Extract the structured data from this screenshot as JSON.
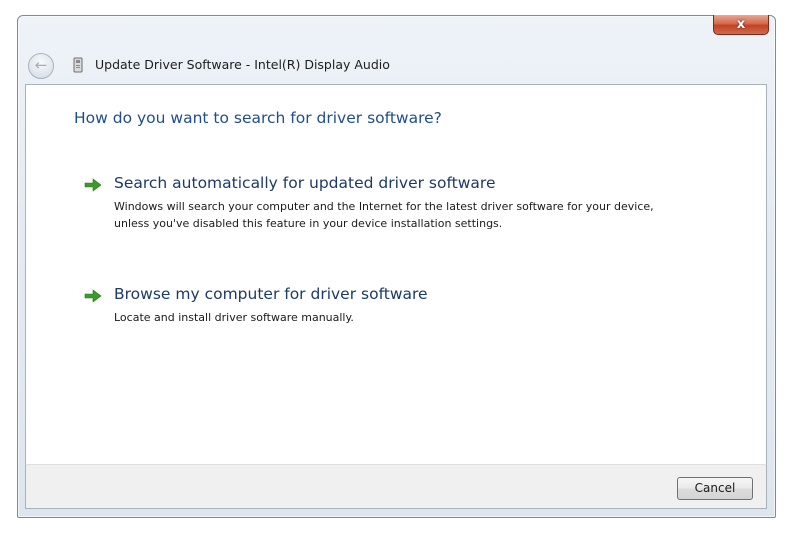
{
  "window": {
    "title": "Update Driver Software - Intel(R) Display Audio",
    "close_label": "x"
  },
  "main": {
    "heading": "How do you want to search for driver software?",
    "options": [
      {
        "title": "Search automatically for updated driver software",
        "description": "Windows will search your computer and the Internet for the latest driver software for your device, unless you've disabled this feature in your device installation settings."
      },
      {
        "title": "Browse my computer for driver software",
        "description": "Locate and install driver software manually."
      }
    ]
  },
  "footer": {
    "cancel_label": "Cancel"
  },
  "icons": {
    "back": "back-arrow-icon",
    "device": "device-icon",
    "option_arrow": "green-arrow-icon"
  },
  "colors": {
    "heading": "#1f4e8c",
    "option_title": "#1d3a66",
    "arrow": "#3a9a2a",
    "close_button": "#c24327"
  }
}
